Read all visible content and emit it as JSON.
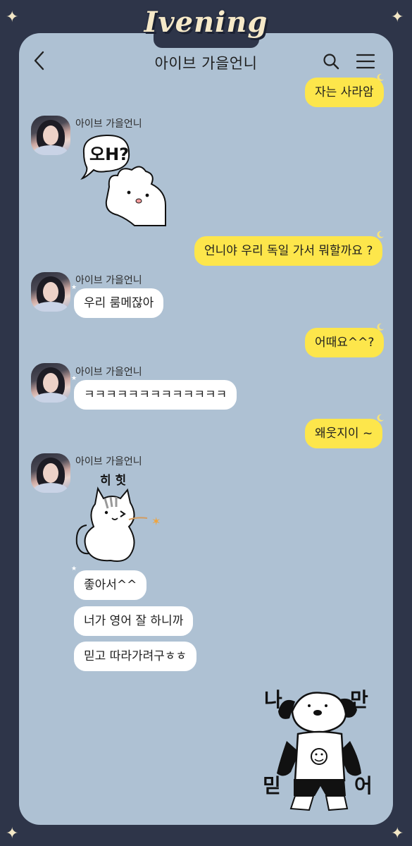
{
  "brand": "Ivening",
  "header": {
    "title": "아이브 가을언니"
  },
  "messages": {
    "m1": "자는 사라암",
    "sender": "아이브 가을언니",
    "sticker_bear_text": "오H?",
    "m2": "언니야 우리 독일 가서 뭐할까요 ?",
    "m3": "우리 룸메잖아",
    "m4": "어때요^^?",
    "m5": "ㅋㅋㅋㅋㅋㅋㅋㅋㅋㅋㅋㅋㅋ",
    "m6": "왜웃지이 ~",
    "sticker_cat_text": "히 힛",
    "m7": "좋아서^^",
    "m8": "너가 영어 잘 하니까",
    "m9": "믿고 따라가려구ㅎㅎ",
    "sticker_dog_1": "나",
    "sticker_dog_2": "만",
    "sticker_dog_3": "믿",
    "sticker_dog_4": "어"
  },
  "icons": [
    "back-arrow-icon",
    "search-icon",
    "menu-icon",
    "moon-icon",
    "star-icon",
    "sparkle-icon"
  ],
  "colors": {
    "background": "#2e3549",
    "chat_background": "#aec1d3",
    "my_bubble": "#fde64b",
    "their_bubble": "#ffffff",
    "brand": "#f6e9c8"
  }
}
